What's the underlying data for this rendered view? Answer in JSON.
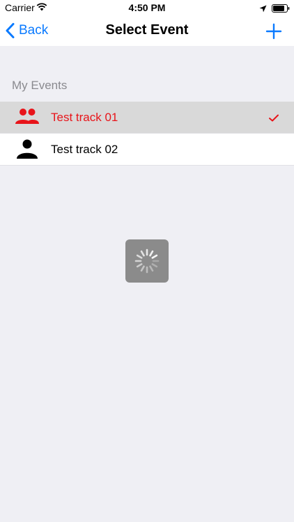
{
  "status_bar": {
    "carrier": "Carrier",
    "time": "4:50 PM"
  },
  "nav": {
    "back_label": "Back",
    "title": "Select Event",
    "accent_color": "#0a7aff"
  },
  "section": {
    "header": "My Events"
  },
  "events": [
    {
      "label": "Test track 01",
      "icon": "group-icon",
      "selected": true,
      "color": "#e8141a"
    },
    {
      "label": "Test track 02",
      "icon": "person-icon",
      "selected": false,
      "color": "#000000"
    }
  ],
  "loading_indicator": "activity-spinner"
}
